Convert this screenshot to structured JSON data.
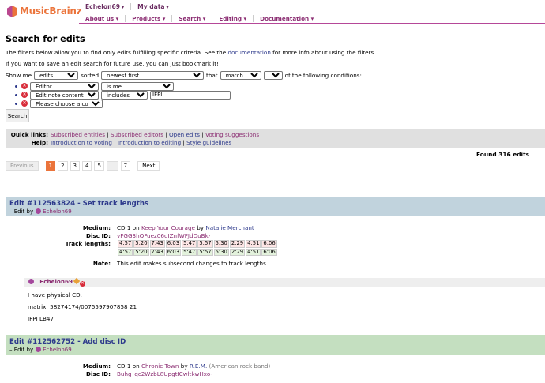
{
  "header": {
    "logo": "MusicBrainz",
    "user_menu": [
      "Echelon69",
      "My data"
    ],
    "nav": [
      "About us",
      "Products",
      "Search",
      "Editing",
      "Documentation"
    ]
  },
  "page": {
    "title": "Search for edits",
    "info_pre": "The filters below allow you to find only edits fulfilling specific criteria. See the ",
    "info_link": "documentation",
    "info_post": " for more info about using the filters.",
    "bookmark_note": "If you want to save an edit search for future use, you can just bookmark it!"
  },
  "form": {
    "show_me": "Show me",
    "show_value": "edits",
    "sorted": "sorted",
    "sorted_value": "newest first",
    "that": "that",
    "match_value": "match",
    "all_value": "all",
    "tail": "of the following conditions:",
    "conditions": [
      {
        "field": "Editor",
        "op": "is me",
        "value": ""
      },
      {
        "field": "Edit note content",
        "op": "includes",
        "value": "IFPI"
      },
      {
        "field": "Please choose a condition",
        "op": "",
        "value": ""
      }
    ],
    "search_button": "Search"
  },
  "quicklinks": {
    "label1": "Quick links:",
    "links1": [
      "Subscribed entities",
      "Subscribed editors",
      "Open edits",
      "Voting suggestions"
    ],
    "label2": "Help:",
    "links2": [
      "Introduction to voting",
      "Introduction to editing",
      "Style guidelines"
    ]
  },
  "found": "Found 316 edits",
  "pager": {
    "prev": "Previous",
    "pages": [
      "1",
      "2",
      "3",
      "4",
      "5",
      "...",
      "7"
    ],
    "next": "Next"
  },
  "edits": [
    {
      "title": "Edit #112563824 - Set track lengths",
      "by_label": "Edit by",
      "editor": "Echelon69",
      "medium_label": "Medium:",
      "medium_pre": "CD 1 on ",
      "release": "Keep Your Courage",
      "by_word": " by ",
      "artist": "Natalie Merchant",
      "discid_label": "Disc ID:",
      "discid": "vFGG3hQFuez06dIZnfWFJdDuBk-",
      "tracklen_label": "Track lengths:",
      "old_lengths": [
        "4:57",
        "5:20",
        "7:43",
        "6:03",
        "5:47",
        "5:57",
        "5:30",
        "2:29",
        "4:51",
        "6:06"
      ],
      "new_lengths": [
        "4:57",
        "5:20",
        "7:43",
        "6:03",
        "5:47",
        "5:57",
        "5:30",
        "2:29",
        "4:51",
        "6:06"
      ],
      "note_label": "Note:",
      "note": "This edit makes subsecond changes to track lengths",
      "edit_note": {
        "author": "Echelon69",
        "lines": [
          "I have physical CD.",
          "matrix: 58274174/0075597907858 21",
          "IFPI LB47"
        ]
      }
    },
    {
      "title": "Edit #112562752 - Add disc ID",
      "by_label": "Edit by",
      "editor": "Echelon69",
      "medium_label": "Medium:",
      "medium_pre": "CD 1 on ",
      "release": "Chronic Town",
      "by_word": " by ",
      "artist": "R.E.M.",
      "artist_comment": " (American rock band)",
      "discid_label": "Disc ID:",
      "discid": "Buhg_qc2WzbL8UpgtICwltkwHxo-"
    }
  ],
  "colors": {
    "edit1_header": "#c1d3dd",
    "edit2_header": "#c4dfc0",
    "accent": "#eb743b",
    "brand_purple": "#b54798"
  }
}
